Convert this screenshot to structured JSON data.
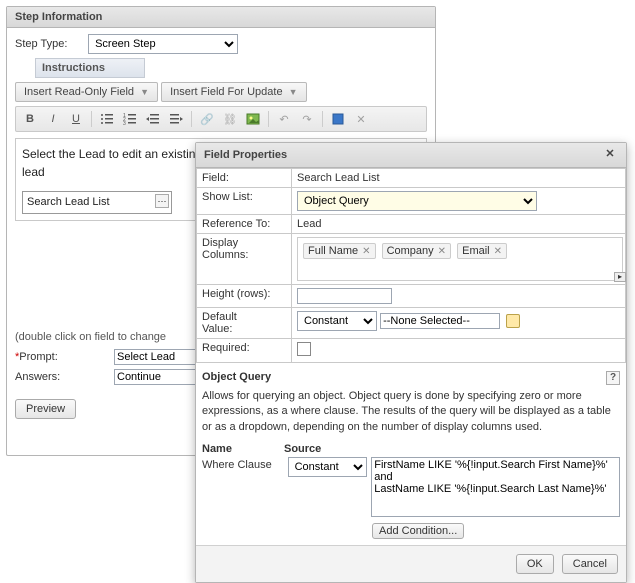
{
  "step_info": {
    "title": "Step Information",
    "step_type_label": "Step Type:",
    "step_type_value": "Screen Step",
    "instructions_label": "Instructions",
    "insert_readonly": "Insert Read-Only Field",
    "insert_update": "Insert Field For Update",
    "rte_text": "Select the Lead to edit an existing lead or press Continue to create a new lead",
    "field_in_editor": "Search Lead List",
    "hint": "(double click on field to change",
    "prompt_label": "Prompt:",
    "prompt_value": "Select Lead",
    "answers_label": "Answers:",
    "answers_value": "Continue",
    "preview_btn": "Preview"
  },
  "field_props": {
    "title": "Field Properties",
    "rows": {
      "field_label": "Field:",
      "field_value": "Search Lead List",
      "showlist_label": "Show List:",
      "showlist_value": "Object Query",
      "reference_label": "Reference To:",
      "reference_value": "Lead",
      "columns_label": "Display Columns:",
      "columns": [
        {
          "label": "Full Name"
        },
        {
          "label": "Company"
        },
        {
          "label": "Email"
        }
      ],
      "height_label": "Height (rows):",
      "height_value": "",
      "default_label": "Default Value:",
      "default_type": "Constant",
      "default_value": "--None Selected--",
      "required_label": "Required:"
    },
    "oq": {
      "heading": "Object Query",
      "desc": "Allows for querying an object. Object query is done by specifying zero or more expressions, as a where clause. The results of the query will be displayed as a table or as a dropdown, depending on the number of display columns used.",
      "name_head": "Name",
      "source_head": "Source",
      "where_label": "Where Clause",
      "source_type": "Constant",
      "source_text": "FirstName LIKE '%{!input.Search First Name}%' and\nLastName LIKE '%{!input.Search Last Name}%'",
      "add_condition": "Add Condition..."
    },
    "ok": "OK",
    "cancel": "Cancel"
  }
}
